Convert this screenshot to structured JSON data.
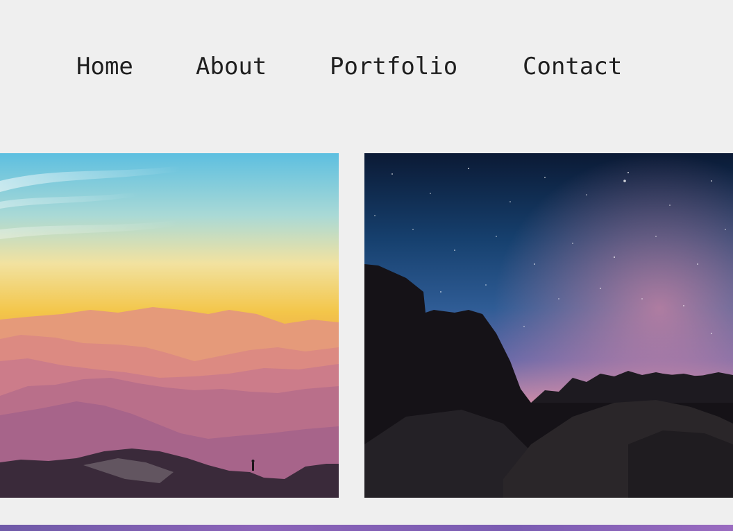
{
  "nav": {
    "items": [
      {
        "label": "Home"
      },
      {
        "label": "About"
      },
      {
        "label": "Portfolio"
      },
      {
        "label": "Contact"
      }
    ]
  },
  "gallery": {
    "photos": [
      {
        "icon": "mountain-sunset-photo"
      },
      {
        "icon": "starry-night-rocks-photo"
      }
    ]
  },
  "colors": {
    "background": "#efefef",
    "nav_text": "#1f1f1f",
    "section_strip": "#7a5cb2"
  }
}
